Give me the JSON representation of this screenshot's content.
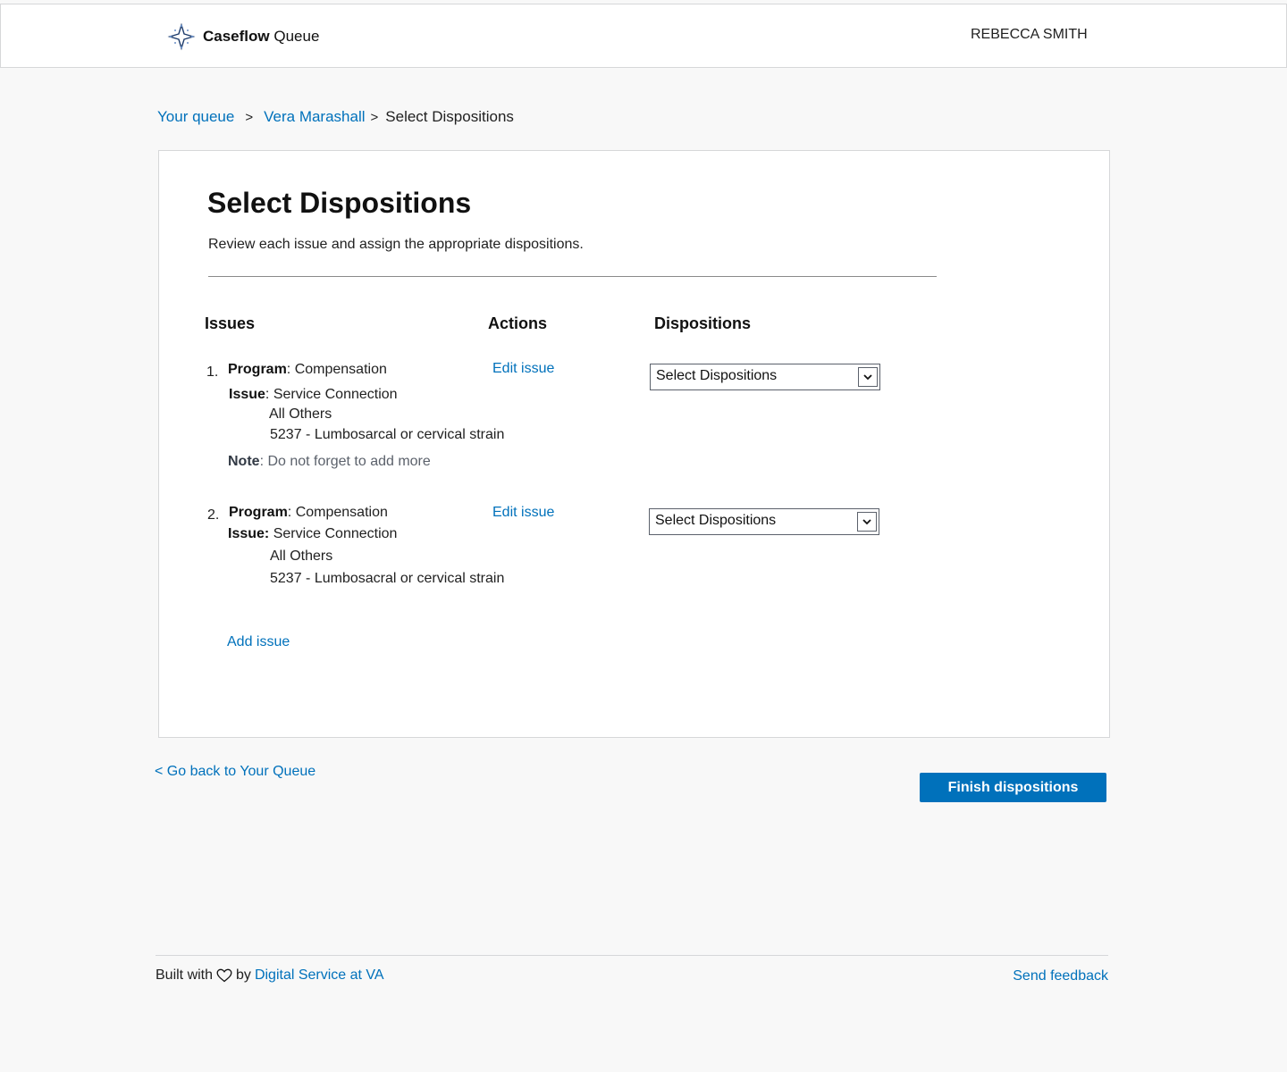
{
  "header": {
    "brand_bold": "Caseflow",
    "brand_light": "Queue",
    "user_name": "REBECCA SMITH"
  },
  "breadcrumb": {
    "items": [
      "Your queue",
      "Vera Marashall",
      "Select Dispositions"
    ],
    "separator": ">"
  },
  "page": {
    "title": "Select Dispositions",
    "subtitle": "Review each issue and assign the appropriate dispositions."
  },
  "table": {
    "headers": {
      "issues": "Issues",
      "actions": "Actions",
      "dispositions": "Dispositions"
    },
    "rows": [
      {
        "number": "1.",
        "program_label": "Program",
        "program_value": ": Compensation",
        "issue_label": "Issue",
        "issue_value": ": Service Connection",
        "levels": [
          "All Others",
          "5237 - Lumbosarcal or cervical strain"
        ],
        "note_label": "Note",
        "note_value": ": Do not forget to add more",
        "action": "Edit issue",
        "disposition": "Select Dispositions"
      },
      {
        "number": "2.",
        "program_label": "Program",
        "program_value": ": Compensation",
        "issue_label": "Issue:",
        "issue_value": " Service Connection",
        "levels": [
          "All Others",
          "5237 - Lumbosacral or cervical strain"
        ],
        "action": "Edit issue",
        "disposition": "Select Dispositions"
      }
    ],
    "add_issue": "Add issue"
  },
  "actions": {
    "back": "< Go back to Your Queue",
    "finish": "Finish dispositions"
  },
  "footer": {
    "built_with": "Built with",
    "by": "by",
    "org_link": "Digital Service at VA",
    "feedback": "Send feedback"
  },
  "colors": {
    "link": "#0071bb",
    "primary_button": "#0071bb",
    "background": "#f8f8f8"
  },
  "icons": [
    "caseflow-logo-icon",
    "chevron-down-icon",
    "heart-icon"
  ]
}
